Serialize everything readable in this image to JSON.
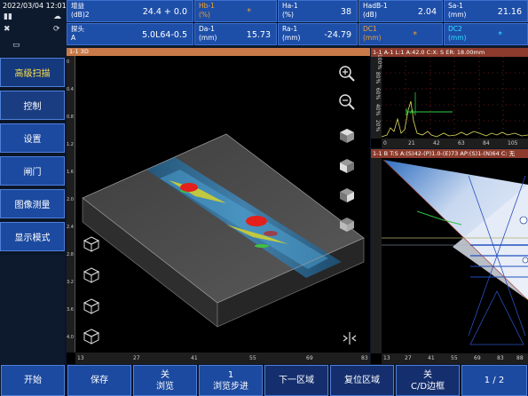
{
  "status": {
    "datetime": "2022/03/04 12:01"
  },
  "params": {
    "row1": [
      {
        "label": "增益\n(dB)2",
        "value": "24.4 + 0.0",
        "color": "white"
      },
      {
        "label": "Hb-1\n(%)",
        "value": "*",
        "color": "orange"
      },
      {
        "label": "Ha-1\n(%)",
        "value": "38",
        "color": "white"
      },
      {
        "label": "HadB-1\n(dB)",
        "value": "2.04",
        "color": "white"
      },
      {
        "label": "Sa-1\n(mm)",
        "value": "21.16",
        "color": "white"
      }
    ],
    "row2": [
      {
        "label": "探头\nA",
        "value": "5.0L64-0.5",
        "color": "white"
      },
      {
        "label": "Da-1\n(mm)",
        "value": "15.73",
        "color": "white"
      },
      {
        "label": "Ra-1\n(mm)",
        "value": "-24.79",
        "color": "white"
      },
      {
        "label": "DC1\n(mm)",
        "value": "*",
        "color": "orange"
      },
      {
        "label": "DC2\n(mm)",
        "value": "*",
        "color": "cyan"
      }
    ]
  },
  "menu": [
    "高级扫描",
    "控制",
    "设置",
    "闸门",
    "图像测量",
    "显示模式"
  ],
  "view3d": {
    "title": "1-1 3D",
    "ruler_left": [
      "0",
      "0.4",
      "0.8",
      "1.2",
      "1.6",
      "2.0",
      "2.4",
      "2.8",
      "3.2",
      "3.6",
      "4.0"
    ],
    "ruler_bottom": [
      "13",
      "27",
      "41",
      "55",
      "69",
      "83"
    ]
  },
  "ascan": {
    "title": "1-1 A-1  L:1  A:42.0  C:X: S     ER: 18.00mm",
    "ruler_left": [
      "100%",
      "80%",
      "60%",
      "40%",
      "20%",
      "0%"
    ],
    "ruler_bottom": [
      "0",
      "21",
      "42",
      "63",
      "84",
      "105"
    ],
    "gate_label": "A"
  },
  "bscan": {
    "title": "1-1 B   T:S A:(S)42-(P)1.0-(E)73 AP:(S)1-(N)64 C: 无",
    "ruler_bottom": [
      "13",
      "27",
      "41",
      "55",
      "69",
      "83",
      "88"
    ]
  },
  "bottom": {
    "start": "开始",
    "save": "保存",
    "browse_state": "关",
    "browse": "浏览",
    "step_value": "1",
    "step": "浏览步进",
    "next_region": "下一区域",
    "reset_region": "复位区域",
    "cd_state": "关",
    "cd": "C/D边框",
    "page": "1 / 2"
  }
}
